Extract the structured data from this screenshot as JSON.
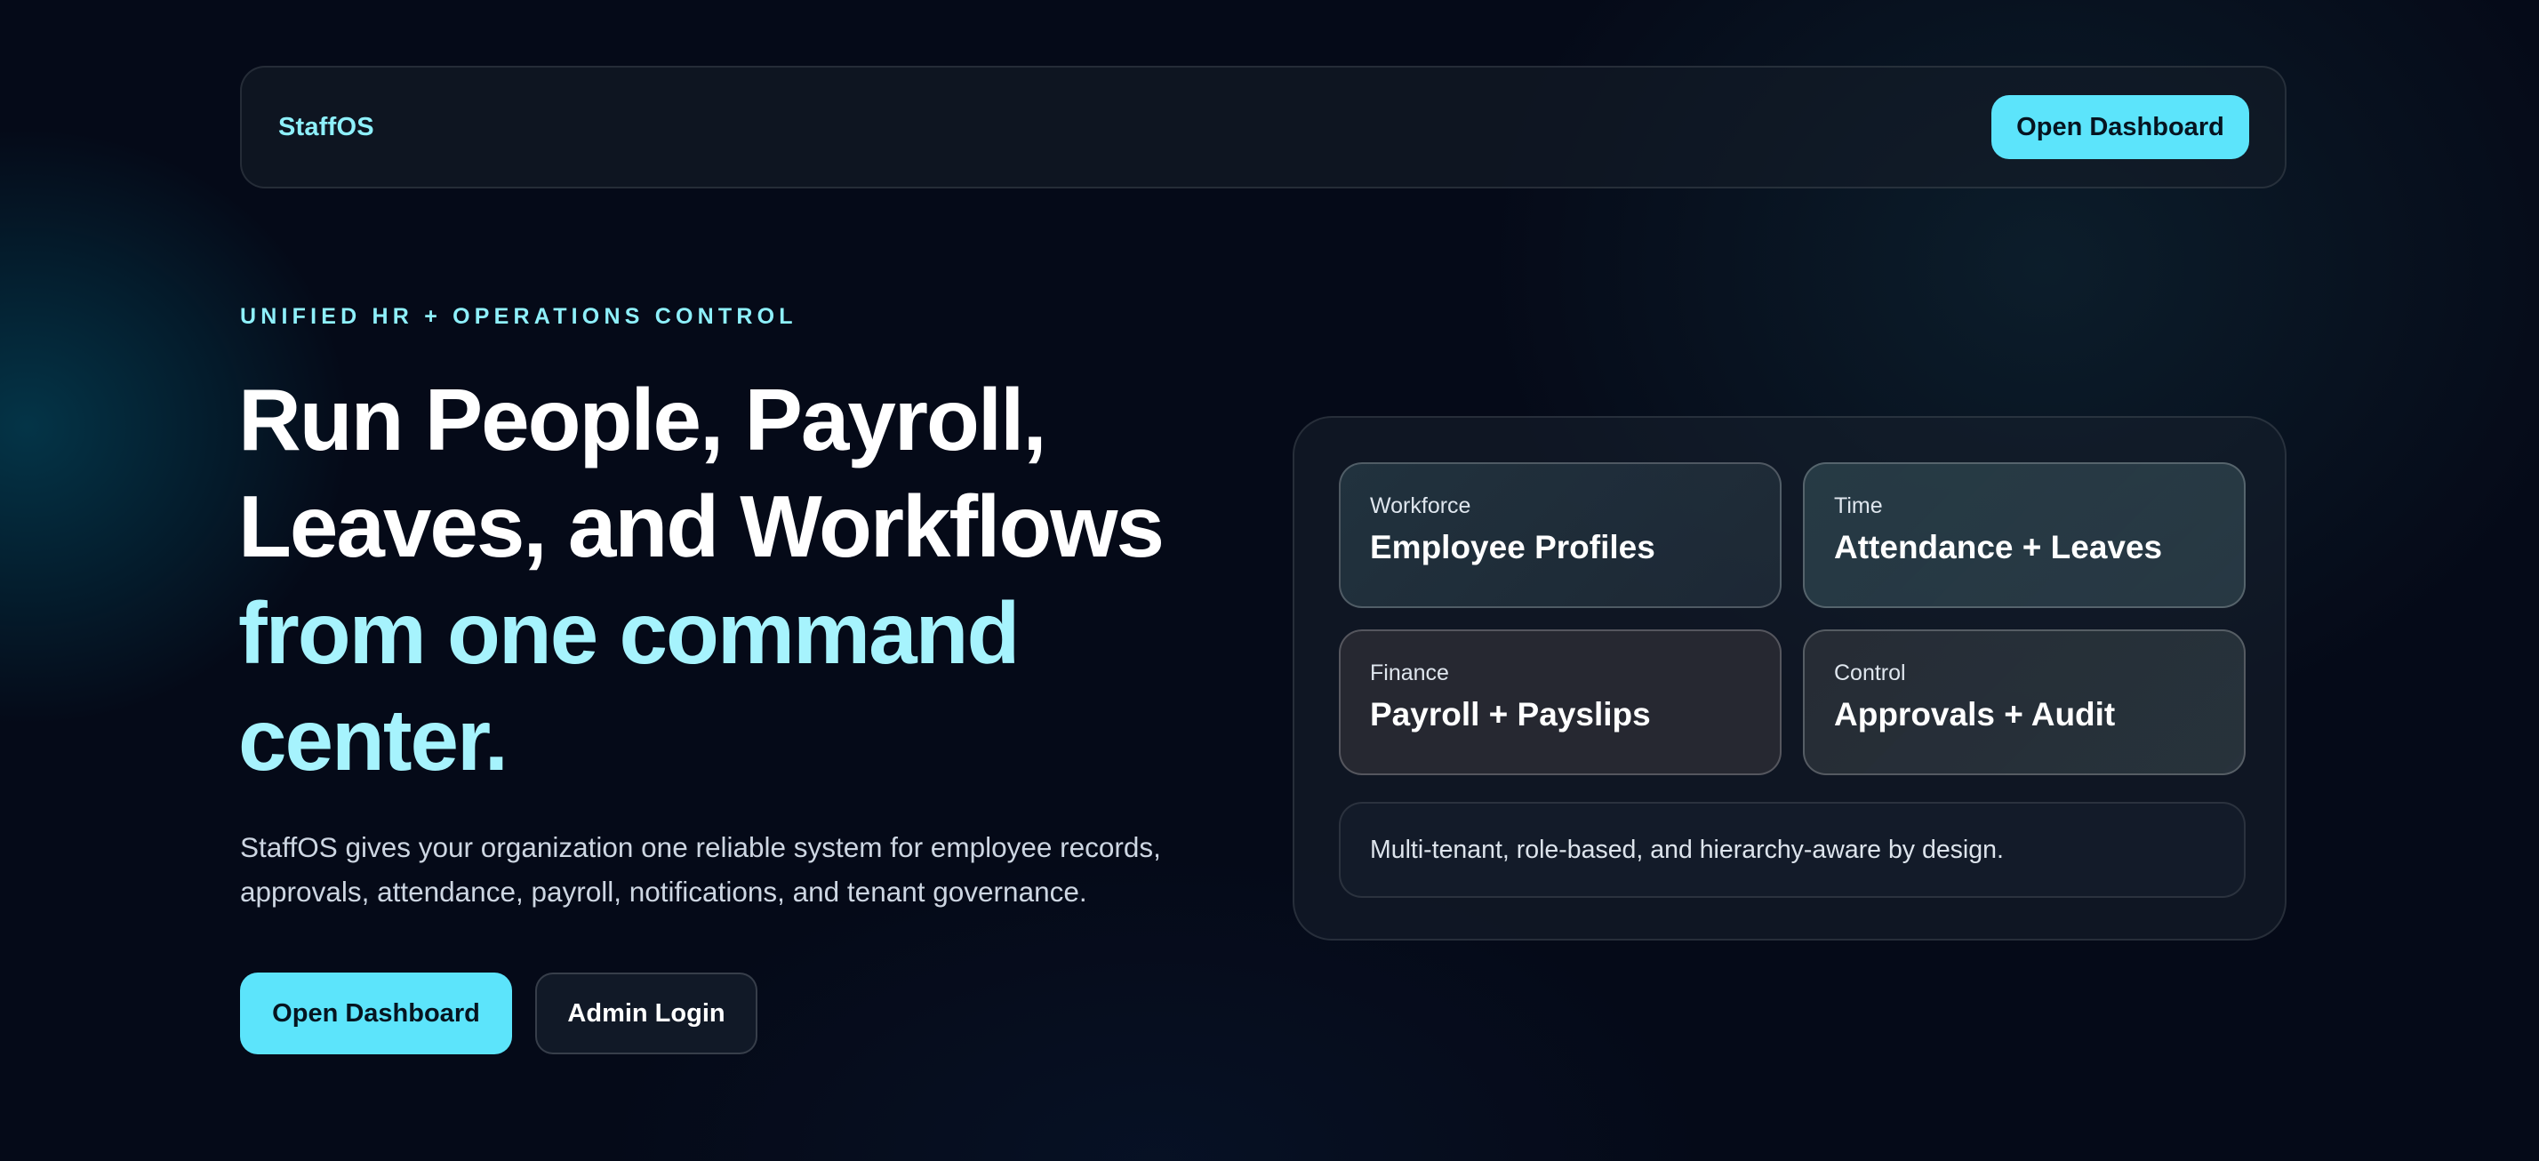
{
  "nav": {
    "brand": "StaffOS",
    "cta_label": "Open Dashboard"
  },
  "hero": {
    "eyebrow": "UNIFIED HR + OPERATIONS CONTROL",
    "headline_lines": [
      "Run People, Payroll,",
      "Leaves, and Workflows"
    ],
    "headline_accent_lines": [
      "from one command",
      "center."
    ],
    "description": "StaffOS gives your organization one reliable system for employee records, approvals, attendance, payroll, notifications, and tenant governance.",
    "primary_cta": "Open Dashboard",
    "secondary_cta": "Admin Login"
  },
  "panel": {
    "cards": [
      {
        "category": "Workforce",
        "title": "Employee Profiles"
      },
      {
        "category": "Time",
        "title": "Attendance + Leaves"
      },
      {
        "category": "Finance",
        "title": "Payroll + Payslips"
      },
      {
        "category": "Control",
        "title": "Approvals + Audit"
      }
    ],
    "note": "Multi-tenant, role-based, and hierarchy-aware by design."
  },
  "colors": {
    "accent": "#5ce4fb",
    "accent_text": "#8ef0fb",
    "background": "#050a18"
  }
}
